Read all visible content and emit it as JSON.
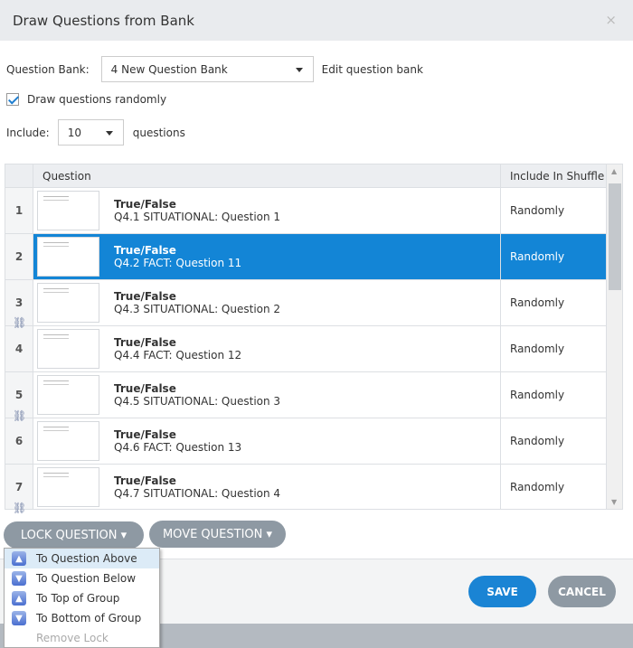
{
  "title": "Draw Questions from Bank",
  "close": "×",
  "bank": {
    "label": "Question Bank:",
    "value": "4 New Question Bank",
    "edit": "Edit question bank"
  },
  "random": {
    "label": "Draw questions randomly",
    "checked": true
  },
  "include": {
    "label": "Include:",
    "value": "10",
    "suffix": "questions"
  },
  "table": {
    "headers": [
      "",
      "Question",
      "Include In Shuffle"
    ],
    "rows": [
      {
        "num": "1",
        "type": "True/False",
        "name": "Q4.1 SITUATIONAL: Question 1",
        "shuffle": "Randomly"
      },
      {
        "num": "2",
        "type": "True/False",
        "name": "Q4.2 FACT: Question 11",
        "shuffle": "Randomly"
      },
      {
        "num": "3",
        "type": "True/False",
        "name": "Q4.3 SITUATIONAL: Question 2",
        "shuffle": "Randomly"
      },
      {
        "num": "4",
        "type": "True/False",
        "name": "Q4.4 FACT: Question 12",
        "shuffle": "Randomly"
      },
      {
        "num": "5",
        "type": "True/False",
        "name": "Q4.5 SITUATIONAL: Question 3",
        "shuffle": "Randomly"
      },
      {
        "num": "6",
        "type": "True/False",
        "name": "Q4.6 FACT: Question 13",
        "shuffle": "Randomly"
      },
      {
        "num": "7",
        "type": "True/False",
        "name": "Q4.7 SITUATIONAL: Question 4",
        "shuffle": "Randomly"
      }
    ]
  },
  "lock_button": "LOCK QUESTION ▾",
  "move_button": "MOVE QUESTION ▾",
  "menu": [
    "To Question Above",
    "To Question Below",
    "To Top of Group",
    "To Bottom of Group",
    "Remove Lock"
  ],
  "save": "SAVE",
  "cancel": "CANCEL"
}
